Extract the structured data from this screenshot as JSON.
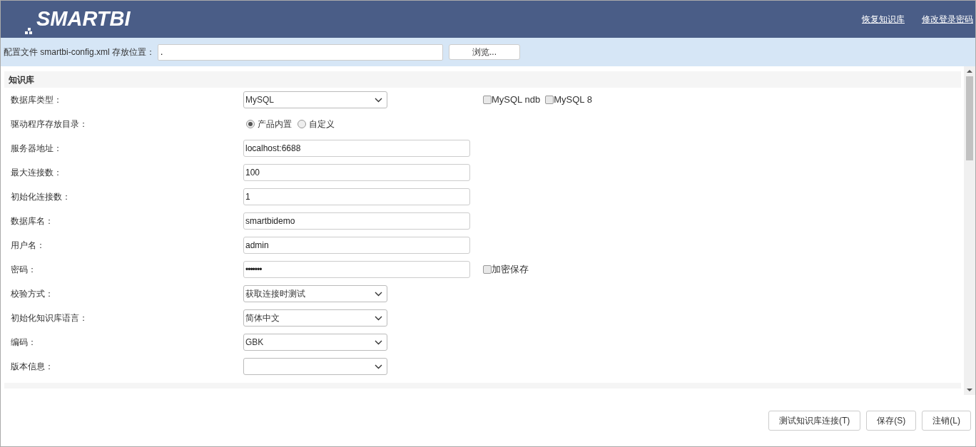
{
  "header": {
    "logo": "SMARTBI",
    "links": [
      "恢复知识库",
      "修改登录密码"
    ]
  },
  "config_bar": {
    "label": "配置文件 smartbi-config.xml 存放位置：",
    "value": ".",
    "button": "浏览..."
  },
  "section": {
    "title": "知识库"
  },
  "fields": [
    {
      "kind": "select",
      "label": "数据库类型：",
      "value": "MySQL",
      "extras": [
        {
          "label": "MySQL ndb",
          "checked": false
        },
        {
          "label": "MySQL 8",
          "checked": false
        }
      ]
    },
    {
      "kind": "radio",
      "label": "驱动程序存放目录：",
      "options": [
        {
          "label": "产品内置",
          "selected": true
        },
        {
          "label": "自定义",
          "selected": false
        }
      ]
    },
    {
      "kind": "text",
      "label": "服务器地址：",
      "value": "localhost:6688"
    },
    {
      "kind": "text",
      "label": "最大连接数：",
      "value": "100"
    },
    {
      "kind": "text",
      "label": "初始化连接数：",
      "value": "1"
    },
    {
      "kind": "text",
      "label": "数据库名：",
      "value": "smartbidemo"
    },
    {
      "kind": "text",
      "label": "用户名：",
      "value": "admin"
    },
    {
      "kind": "password",
      "label": "密码：",
      "value": "•••••••",
      "extras": [
        {
          "label": "加密保存",
          "checked": false
        }
      ]
    },
    {
      "kind": "select",
      "label": "校验方式：",
      "value": "获取连接时测试"
    },
    {
      "kind": "select",
      "label": "初始化知识库语言：",
      "value": "简体中文"
    },
    {
      "kind": "select",
      "label": "编码：",
      "value": "GBK"
    },
    {
      "kind": "select",
      "label": "版本信息："
    }
  ],
  "footer_buttons": [
    "测试知识库连接(T)",
    "保存(S)",
    "注销(L)"
  ]
}
